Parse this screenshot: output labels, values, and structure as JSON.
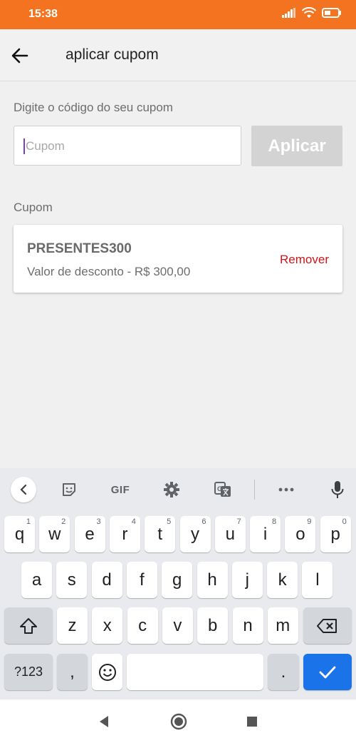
{
  "status_bar": {
    "time": "15:38"
  },
  "app_bar": {
    "title": "aplicar cupom"
  },
  "form": {
    "label": "Digite o código do seu cupom",
    "input_placeholder": "Cupom",
    "input_value": "",
    "apply_label": "Aplicar"
  },
  "coupon_section": {
    "label": "Cupom",
    "code": "PRESENTES300",
    "discount": "Valor de desconto - R$ 300,00",
    "remove_label": "Remover"
  },
  "keyboard": {
    "toolbar": {
      "gif": "GIF"
    },
    "row1": [
      {
        "key": "q",
        "hint": "1"
      },
      {
        "key": "w",
        "hint": "2"
      },
      {
        "key": "e",
        "hint": "3"
      },
      {
        "key": "r",
        "hint": "4"
      },
      {
        "key": "t",
        "hint": "5"
      },
      {
        "key": "y",
        "hint": "6"
      },
      {
        "key": "u",
        "hint": "7"
      },
      {
        "key": "i",
        "hint": "8"
      },
      {
        "key": "o",
        "hint": "9"
      },
      {
        "key": "p",
        "hint": "0"
      }
    ],
    "row2": [
      "a",
      "s",
      "d",
      "f",
      "g",
      "h",
      "j",
      "k",
      "l"
    ],
    "row3": [
      "z",
      "x",
      "c",
      "v",
      "b",
      "n",
      "m"
    ],
    "symbols_label": "?123",
    "comma": ",",
    "period": "."
  },
  "colors": {
    "status_bar": "#f47321",
    "remove": "#d0141c",
    "apply_disabled": "#d3d3d3",
    "keyboard_action": "#1a73e8"
  }
}
